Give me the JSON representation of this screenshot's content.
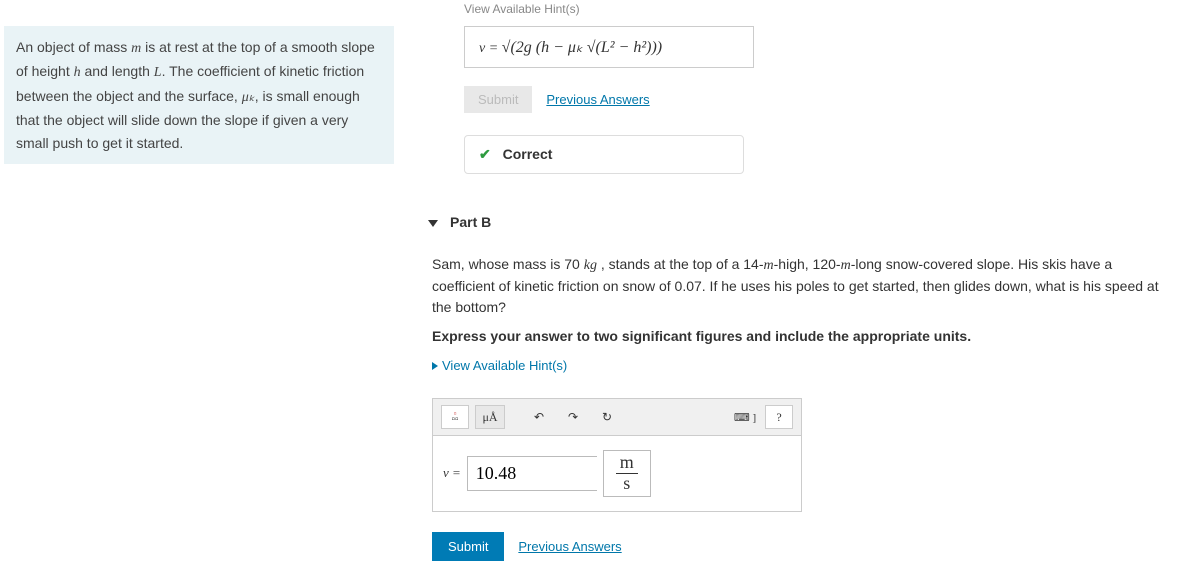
{
  "problem": {
    "text_before_m": "An object of mass ",
    "m": "m",
    "text_after_m": " is at rest at the top of a smooth slope of height ",
    "h": "h",
    "text_after_h": " and length ",
    "L": "L",
    "text_after_L": ". The coefficient of kinetic friction between the object and the surface, ",
    "mu": "μₖ",
    "text_after_mu": ", is small enough that the object will slide down the slope if given a very small push to get it started."
  },
  "hints_top_trunc": "View Available Hint(s)",
  "partA": {
    "formula_prefix": "v = ",
    "formula_body": "√(2g (h − μₖ √(L² − h²)))",
    "submit": "Submit",
    "prev": "Previous Answers",
    "correct": "Correct"
  },
  "partB": {
    "header": "Part B",
    "q1": "Sam, whose mass is 70 ",
    "kg": "kg",
    "q2": " , stands at the top of a 14-",
    "m_unit": "m",
    "q3": "-high, 120-",
    "q4": "-long snow-covered slope. His skis have a coefficient of kinetic friction on snow of 0.07. If he uses his poles to get started, then glides down, what is his speed at the bottom?",
    "instr": "Express your answer to two significant figures and include the appropriate units.",
    "hints": "View Available Hint(s)",
    "tool_templates": "▫▫",
    "tool_units": "μÅ",
    "tool_undo": "↶",
    "tool_redo": "↷",
    "tool_reset": "↻",
    "tool_keyboard": "⌨ ]",
    "tool_help": "?",
    "ans_prefix": "v = ",
    "ans_value": "10.48",
    "unit_top": "m",
    "unit_bot": "s",
    "submit": "Submit",
    "prev": "Previous Answers"
  }
}
